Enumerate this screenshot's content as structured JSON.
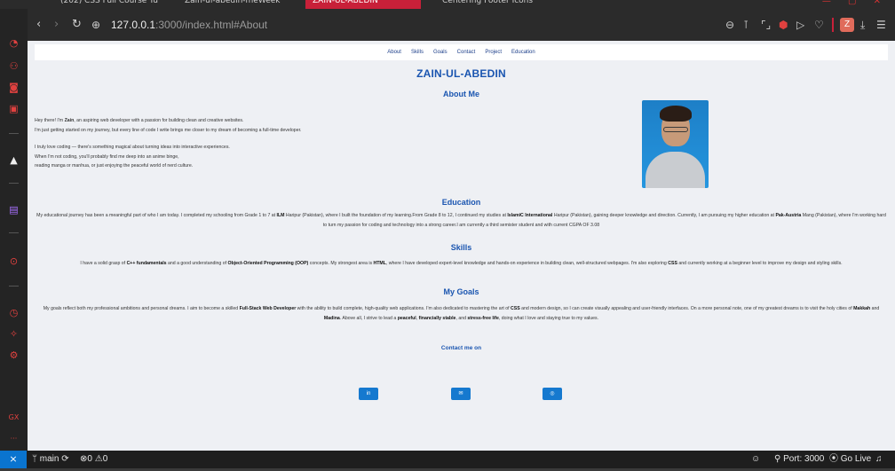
{
  "browser": {
    "tabs": [
      {
        "label": "(202) CSS Full Course Tu",
        "active": false
      },
      {
        "label": "Zain-ul-abedin-meWeek",
        "active": false
      },
      {
        "label": "ZAIN-UL-ABEDIN",
        "active": true
      },
      {
        "label": "Centering Footer Icons",
        "active": false
      }
    ],
    "url_host": "127.0.0.1",
    "url_path": ":3000/index.html#About",
    "profile_initial": "Z"
  },
  "page": {
    "nav": [
      "About",
      "Skills",
      "Goals",
      "Contact",
      "Project",
      "Education"
    ],
    "title": "ZAIN-UL-ABEDIN",
    "about": {
      "heading": "About Me",
      "p1_before": "Hey there! I'm ",
      "p1_name": "Zain",
      "p1_after": ", an aspiring web developer with a passion for building clean and creative websites.",
      "p1_line2": "I'm just getting started on my journey, but every line of code I write brings me closer to my dream of becoming a full-time developer.",
      "p2_line1": "I truly love coding — there's something magical about turning ideas into interactive experiences.",
      "p2_line2": "When I'm not coding, you'll probably find me deep into an anime binge,",
      "p2_line3": "reading manga or manhua, or just enjoying the peaceful world of nerd culture."
    },
    "education": {
      "heading": "Education",
      "t1": "My educational journey has been a meaningful part of who I am today. I completed my schooling from Grade 1 to 7 at ",
      "b1": "ILM",
      "t2": " Haripur (Pakistan), where I built the foundation of my learning.From Grade 8 to 12, I continued my studies at ",
      "b2": "IslamiC International",
      "t3": " Haripur (Pakistan), gaining deeper knowledge and direction. Currently, I am pursuing my higher education at ",
      "b3": "Pak-Austria",
      "t4": " Mang (Pakistan), where I'm working hard to turn my passion for coding and technology into a strong career.I am currently a third semister student and with current CGPA OF 3.08"
    },
    "skills": {
      "heading": "Skills",
      "t1": "I have a solid grasp of ",
      "b1": "C++ fundamentals",
      "t2": " and a good understanding of ",
      "b2": "Object-Oriented Programming (OOP)",
      "t3": " concepts. My strongest area is ",
      "b3": "HTML",
      "t4": ", where I have developed expert-level knowledge and hands-on experience in building clean, well-structured webpages. I'm also exploring ",
      "b4": "CSS",
      "t5": " and currently working at a beginner level to improve my design and styling skills."
    },
    "goals": {
      "heading": "My Goals",
      "t1": "My goals reflect both my professional ambitions and personal dreams. I aim to become a skilled ",
      "b1": "Full-Stack Web Developer",
      "t2": " with the ability to build complete, high-quality web applications. I'm also dedicated to mastering the art of ",
      "b2": "CSS",
      "t3": " and modern design, so I can create visually appealing and user-friendly interfaces. On a more personal note, one of my greatest dreams is to visit the holy cities of ",
      "b3": "Makkah",
      "t4": " and ",
      "b4": "Madina",
      "t5": ". Above all, I strive to lead a ",
      "b5": "peaceful",
      "t6": ", ",
      "b6": "financially stable",
      "t7": ", and ",
      "b7": "stress-free life",
      "t8": ", doing what I love and staying true to my values."
    },
    "contact": {
      "heading": "Contact me on",
      "buttons": [
        "in",
        "✉",
        "◎"
      ]
    }
  },
  "statusbar": {
    "branch": "main",
    "errors": "0",
    "warnings": "0",
    "port": "Port: 3000",
    "golive": "Go Live"
  },
  "colors": {
    "accent_blue": "#1a55b0",
    "button_blue": "#1579cf",
    "browser_red": "#c82039"
  }
}
